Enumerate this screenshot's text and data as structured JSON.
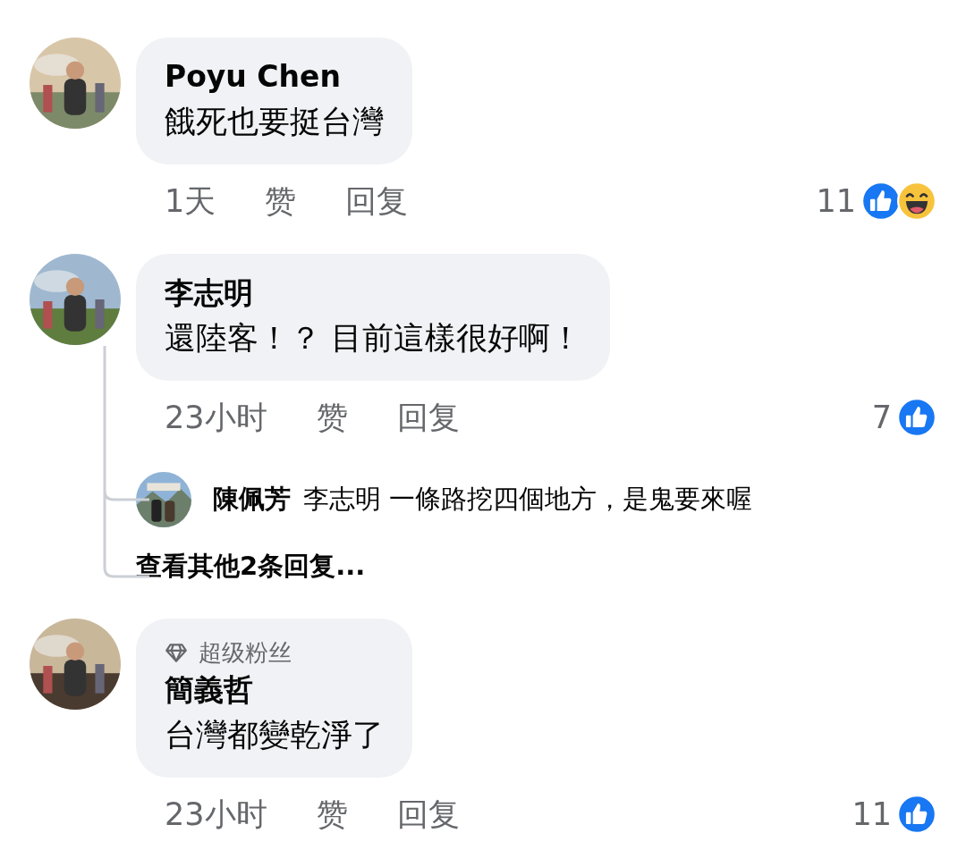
{
  "comments": [
    {
      "name": "Poyu Chen",
      "text": "餓死也要挺台灣",
      "time": "1天",
      "like": "赞",
      "reply": "回复",
      "count": "11",
      "reactions": [
        {
          "kind": "like"
        },
        {
          "kind": "haha"
        }
      ]
    },
    {
      "name": "李志明",
      "text": "還陸客！？ 目前這樣很好啊！",
      "time": "23小时",
      "like": "赞",
      "reply": "回复",
      "count": "7",
      "reactions": [
        {
          "kind": "like"
        }
      ],
      "replies": [
        {
          "name": "陳佩芳",
          "text": "李志明 一條路挖四個地方，是鬼要來喔"
        }
      ],
      "more_replies": "查看其他2条回复..."
    },
    {
      "badge": "超级粉丝",
      "name": "簡義哲",
      "text": "台灣都變乾淨了",
      "time": "23小时",
      "like": "赞",
      "reply": "回复",
      "count": "11",
      "reactions": [
        {
          "kind": "like"
        }
      ]
    }
  ]
}
